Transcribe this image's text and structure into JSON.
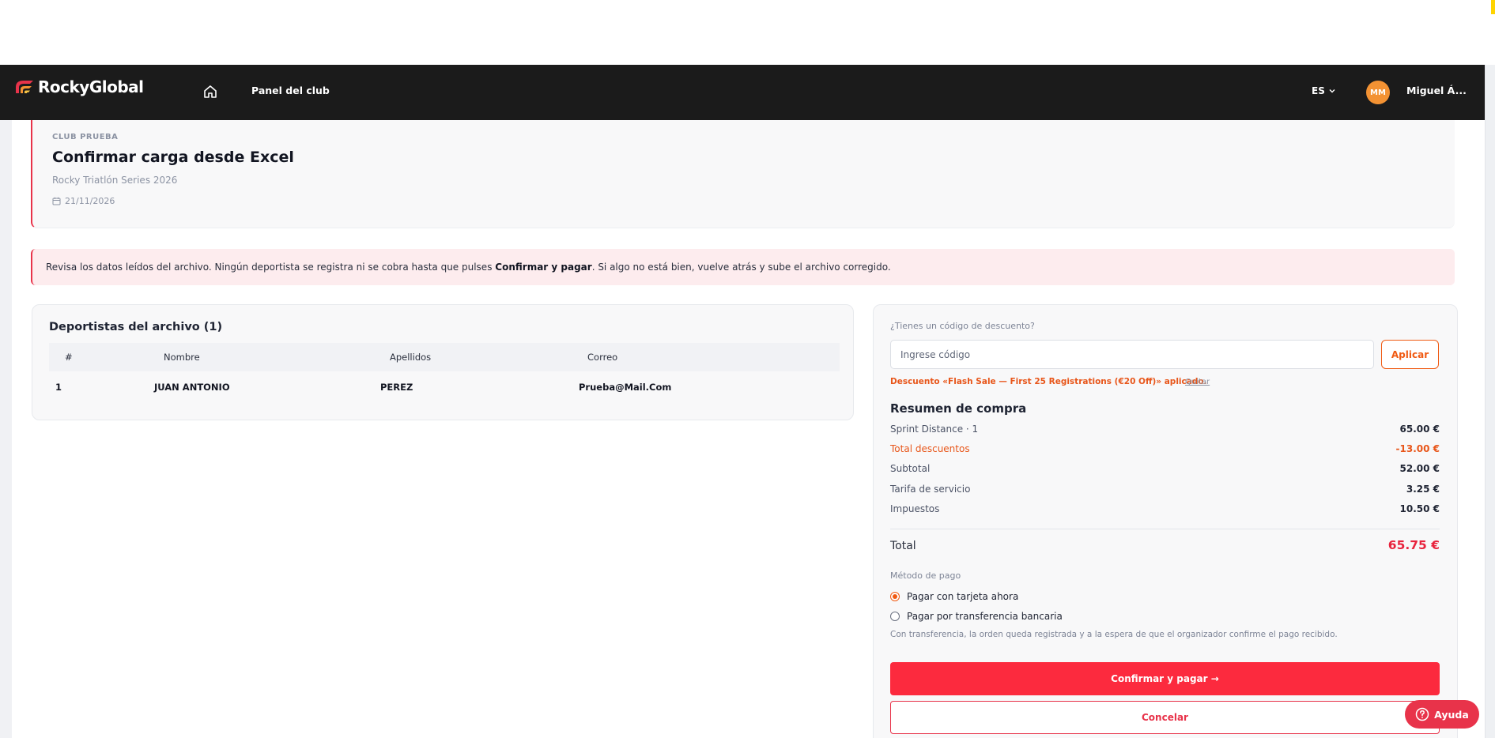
{
  "app": {
    "logo_text": "RockyGlobal"
  },
  "nav": {
    "home_icon": "home-icon",
    "panel_label": "Panel del club",
    "language": "ES",
    "avatar_initials": "MM",
    "user_name": "Miguel Á..."
  },
  "header": {
    "club_name": "CLUB PRUEBA",
    "title": "Confirmar carga desde Excel",
    "event_name": "Rocky Triatlón Series 2026",
    "event_date": "21/11/2026"
  },
  "notice": {
    "text_before": "Revisa los datos leídos del archivo. Ningún deportista se registra ni se cobra hasta que pulses ",
    "bold": "Confirmar y pagar",
    "text_after": ". Si algo no está bien, vuelve atrás y sube el archivo corregido."
  },
  "athletes": {
    "title": "Deportistas del archivo (1)",
    "columns": [
      "#",
      "Nombre",
      "Apellidos",
      "Correo"
    ],
    "rows": [
      {
        "num": "1",
        "nombre": "JUAN ANTONIO",
        "apellidos": "PEREZ",
        "correo": "Prueba@Mail.Com"
      }
    ]
  },
  "discount": {
    "question": "¿Tienes un código de descuento?",
    "placeholder": "Ingrese código",
    "apply_label": "Aplicar",
    "applied_text": "Descuento «Flash Sale — First 25 Registrations (€20 Off)» aplicado.",
    "remove_label": "Quitar"
  },
  "summary": {
    "title": "Resumen de compra",
    "items": [
      {
        "label": "Sprint Distance · 1",
        "value": "65.00 €"
      },
      {
        "label": "Total descuentos",
        "value": "-13.00 €"
      },
      {
        "label": "Subtotal",
        "value": "52.00 €"
      },
      {
        "label": "Tarifa de servicio",
        "value": "3.25 €"
      },
      {
        "label": "Impuestos",
        "value": "10.50 €"
      }
    ],
    "total_label": "Total",
    "total_value": "65.75 €"
  },
  "payment": {
    "title": "Método de pago",
    "options": [
      "Pagar con tarjeta ahora",
      "Pagar por transferencia bancaria"
    ],
    "selected_index": 0,
    "note": "Con transferencia, la orden queda registrada y a la espera de que el organizador confirme el pago recibido."
  },
  "actions": {
    "confirm_label": "Confirmar y pagar →",
    "cancel_label": "Concelar"
  },
  "help": {
    "label": "Ayuda"
  },
  "colors": {
    "brand_red": "#fc2a3e",
    "accent_orange": "#f05a12",
    "navbar_bg": "#1b1b1b"
  }
}
